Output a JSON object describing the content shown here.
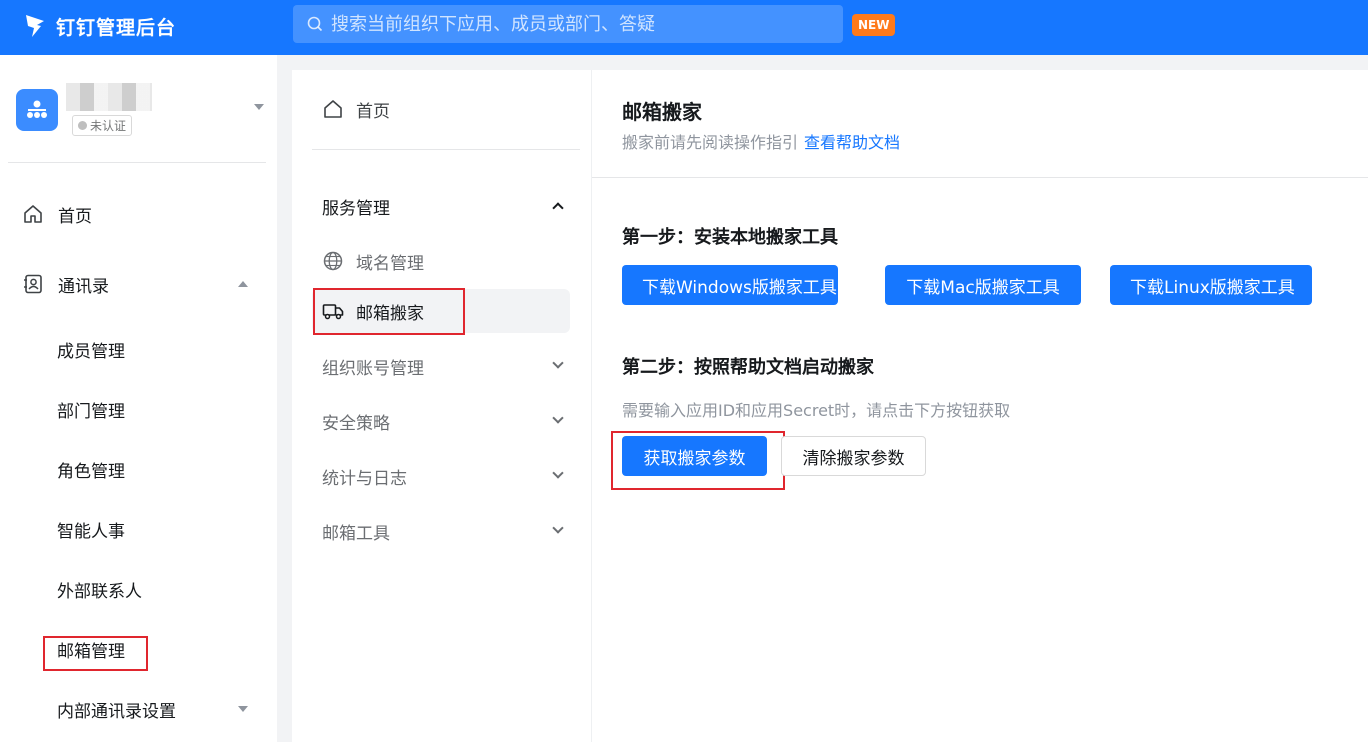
{
  "topbar": {
    "brand": "钉钉管理后台",
    "search_placeholder": "搜索当前组织下应用、成员或部门、答疑",
    "new_badge": "NEW"
  },
  "org": {
    "status": "未认证"
  },
  "sidebar": {
    "home": "首页",
    "contacts": "通讯录",
    "sub_items": [
      "成员管理",
      "部门管理",
      "角色管理",
      "智能人事",
      "外部联系人",
      "邮箱管理",
      "内部通讯录设置"
    ]
  },
  "midnav": {
    "home": "首页",
    "service_group": "服务管理",
    "service_items": [
      "域名管理",
      "邮箱搬家"
    ],
    "groups": [
      "组织账号管理",
      "安全策略",
      "统计与日志",
      "邮箱工具"
    ]
  },
  "content": {
    "title": "邮箱搬家",
    "subtitle": "搬家前请先阅读操作指引",
    "help_link": "查看帮助文档",
    "step1_title": "第一步：安装本地搬家工具",
    "step1_buttons": [
      "下载Windows版搬家工具",
      "下载Mac版搬家工具",
      "下载Linux版搬家工具"
    ],
    "step2_title": "第二步：按照帮助文档启动搬家",
    "step2_hint": "需要输入应用ID和应用Secret时，请点击下方按钮获取",
    "get_params": "获取搬家参数",
    "clear_params": "清除搬家参数"
  },
  "colors": {
    "primary": "#1677ff",
    "new_badge": "#ff7a1a",
    "highlight_box": "#e0262e"
  }
}
